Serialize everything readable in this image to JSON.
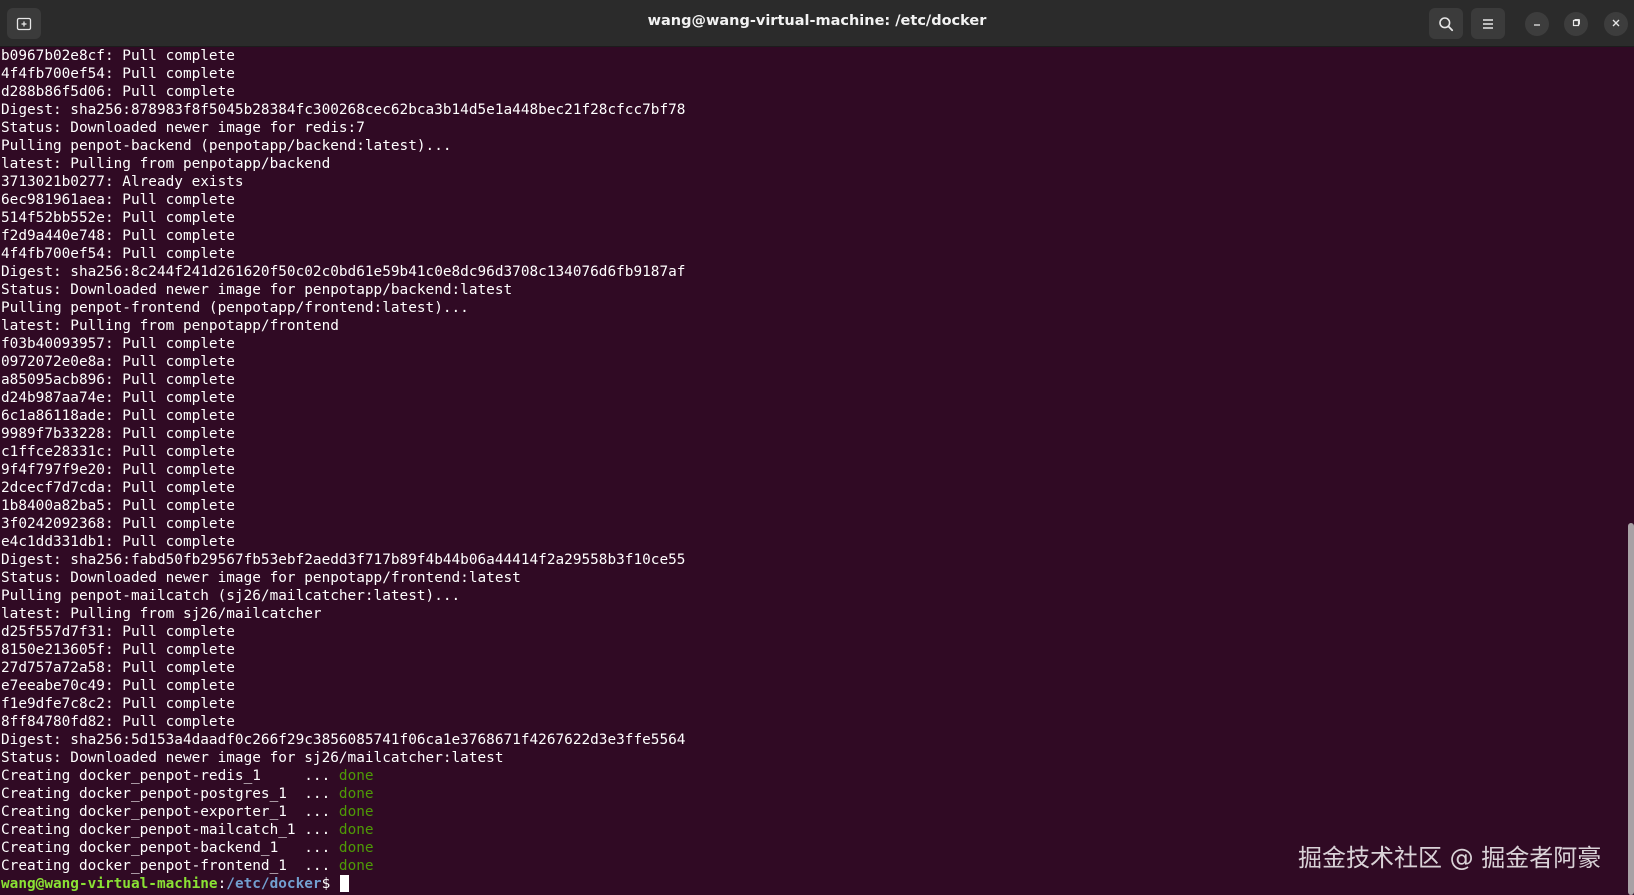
{
  "window": {
    "title": "wang@wang-virtual-machine: /etc/docker"
  },
  "icons": {
    "new_tab": "new-tab-icon",
    "search": "search-icon",
    "menu": "hamburger-menu-icon",
    "minimize": "minimize-icon",
    "maximize": "maximize-icon",
    "close": "close-icon"
  },
  "colors": {
    "background": "#300a24",
    "text": "#ffffff",
    "done": "#4e9a06",
    "prompt_user": "#8ae234",
    "prompt_path": "#729fcf"
  },
  "terminal": {
    "lines": [
      "b0967b02e8cf: Pull complete",
      "4f4fb700ef54: Pull complete",
      "d288b86f5d06: Pull complete",
      "Digest: sha256:878983f8f5045b28384fc300268cec62bca3b14d5e1a448bec21f28cfcc7bf78",
      "Status: Downloaded newer image for redis:7",
      "Pulling penpot-backend (penpotapp/backend:latest)...",
      "latest: Pulling from penpotapp/backend",
      "3713021b0277: Already exists",
      "6ec981961aea: Pull complete",
      "514f52bb552e: Pull complete",
      "f2d9a440e748: Pull complete",
      "4f4fb700ef54: Pull complete",
      "Digest: sha256:8c244f241d261620f50c02c0bd61e59b41c0e8dc96d3708c134076d6fb9187af",
      "Status: Downloaded newer image for penpotapp/backend:latest",
      "Pulling penpot-frontend (penpotapp/frontend:latest)...",
      "latest: Pulling from penpotapp/frontend",
      "f03b40093957: Pull complete",
      "0972072e0e8a: Pull complete",
      "a85095acb896: Pull complete",
      "d24b987aa74e: Pull complete",
      "6c1a86118ade: Pull complete",
      "9989f7b33228: Pull complete",
      "c1ffce28331c: Pull complete",
      "9f4f797f9e20: Pull complete",
      "2dcecf7d7cda: Pull complete",
      "1b8400a82ba5: Pull complete",
      "3f0242092368: Pull complete",
      "e4c1dd331db1: Pull complete",
      "Digest: sha256:fabd50fb29567fb53ebf2aedd3f717b89f4b44b06a44414f2a29558b3f10ce55",
      "Status: Downloaded newer image for penpotapp/frontend:latest",
      "Pulling penpot-mailcatch (sj26/mailcatcher:latest)...",
      "latest: Pulling from sj26/mailcatcher",
      "d25f557d7f31: Pull complete",
      "8150e213605f: Pull complete",
      "27d757a72a58: Pull complete",
      "e7eeabe70c49: Pull complete",
      "f1e9dfe7c8c2: Pull complete",
      "8ff84780fd82: Pull complete",
      "Digest: sha256:5d153a4daadf0c266f29c3856085741f06ca1e3768671f4267622d3e3ffe5564",
      "Status: Downloaded newer image for sj26/mailcatcher:latest"
    ],
    "creating": [
      {
        "text": "Creating docker_penpot-redis_1     ... ",
        "status": "done"
      },
      {
        "text": "Creating docker_penpot-postgres_1  ... ",
        "status": "done"
      },
      {
        "text": "Creating docker_penpot-exporter_1  ... ",
        "status": "done"
      },
      {
        "text": "Creating docker_penpot-mailcatch_1 ... ",
        "status": "done"
      },
      {
        "text": "Creating docker_penpot-backend_1   ... ",
        "status": "done"
      },
      {
        "text": "Creating docker_penpot-frontend_1  ... ",
        "status": "done"
      }
    ],
    "prompt": {
      "user_host": "wang@wang-virtual-machine",
      "separator": ":",
      "path": "/etc/docker",
      "symbol": "$ "
    }
  },
  "watermark": "掘金技术社区 @ 掘金者阿豪"
}
